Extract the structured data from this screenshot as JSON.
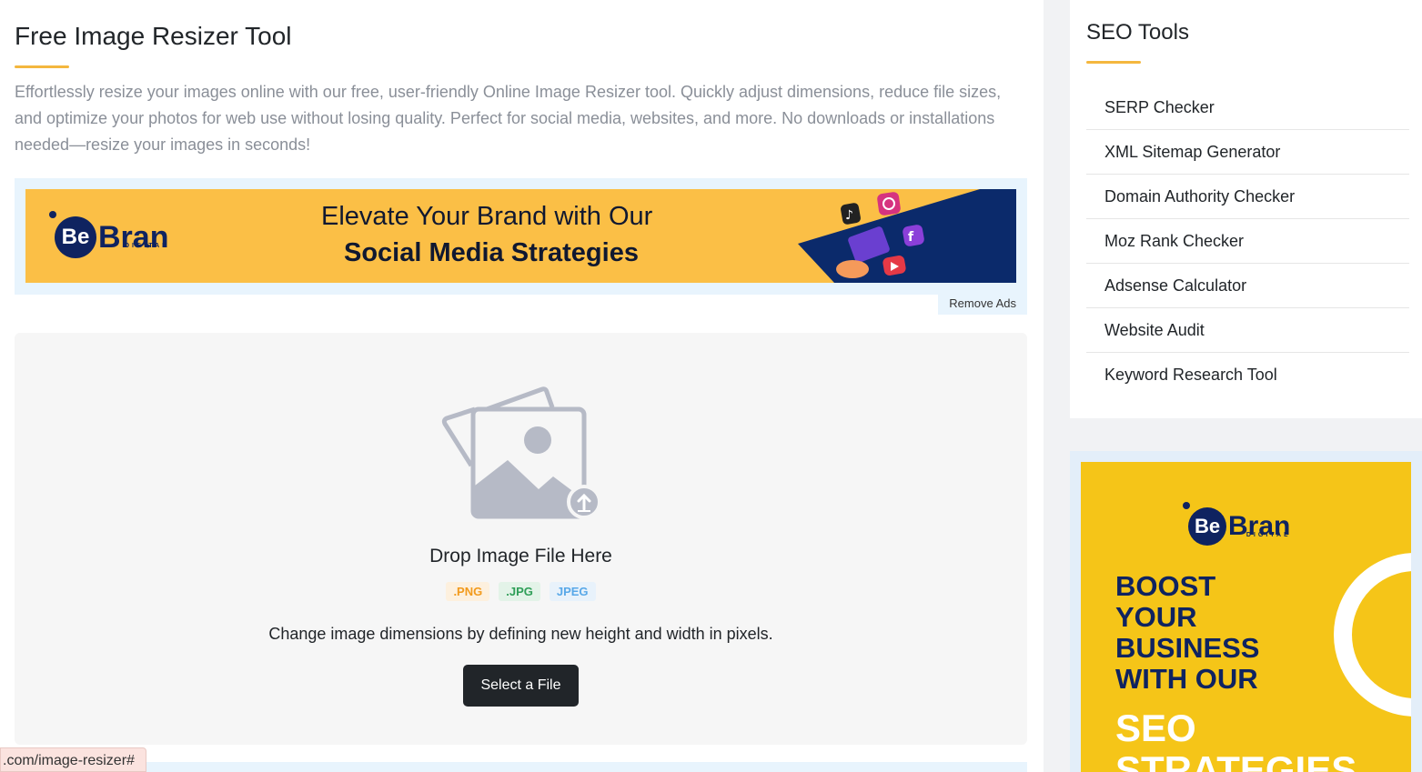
{
  "header": {
    "title": "Free Image Resizer Tool",
    "description": "Effortlessly resize your images online with our free, user-friendly Online Image Resizer tool. Quickly adjust dimensions, reduce file sizes, and optimize your photos for web use without losing quality. Perfect for social media, websites, and more. No downloads or installations needed—resize your images in seconds!"
  },
  "top_ad": {
    "logo_be": "Be",
    "logo_word": "Bran",
    "logo_sub": "DIGITAL",
    "line1": "Elevate Your Brand with Our",
    "line2": "Social Media Strategies",
    "remove_ads": "Remove Ads"
  },
  "upload": {
    "title": "Drop Image File Here",
    "formats": [
      ".PNG",
      ".JPG",
      "JPEG"
    ],
    "subtitle": "Change image dimensions by defining new height and width in pixels.",
    "button": "Select a File"
  },
  "sidebar": {
    "title": "SEO Tools",
    "items": [
      "SERP Checker",
      "XML Sitemap Generator",
      "Domain Authority Checker",
      "Moz Rank Checker",
      "Adsense Calculator",
      "Website Audit",
      "Keyword Research Tool"
    ]
  },
  "side_ad": {
    "logo_be": "Be",
    "logo_word": "Bran",
    "logo_sub": "DIGITAL",
    "line1": "BOOST",
    "line2": "YOUR",
    "line3": "BUSINESS",
    "line4": "WITH OUR",
    "line5": "SEO",
    "line6": "STRATEGIES"
  },
  "status_bar": {
    "url": ".com/image-resizer#"
  },
  "colors": {
    "accent": "#f4b73e",
    "dark_button": "#212529",
    "ad_yellow": "#fbbf46",
    "brand_navy": "#0f2360"
  }
}
